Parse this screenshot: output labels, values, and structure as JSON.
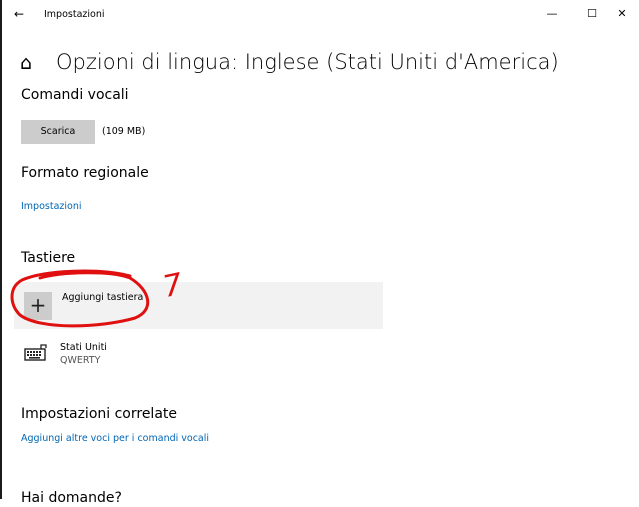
{
  "window": {
    "back_glyph": "←",
    "title": "Impostazioni",
    "minimize_glyph": "—",
    "maximize_glyph": "☐",
    "close_glyph": "✕"
  },
  "page": {
    "home_icon": "home-icon",
    "title": "Opzioni di lingua: Inglese (Stati Uniti d'America)"
  },
  "voice": {
    "header": "Comandi vocali",
    "download_label": "Scarica",
    "size": "(109 MB)"
  },
  "regional": {
    "header": "Formato regionale",
    "settings_link": "Impostazioni"
  },
  "keyboards": {
    "header": "Tastiere",
    "add_label": "Aggiungi tastiera",
    "add_icon": "plus-icon",
    "items": [
      {
        "name": "Stati Uniti",
        "layout": "QWERTY",
        "icon": "keyboard-icon"
      }
    ]
  },
  "related": {
    "header": "Impostazioni correlate",
    "link": "Aggiungi altre voci per i comandi vocali"
  },
  "questions": {
    "header": "Hai domande?"
  },
  "annotation": {
    "number": "7",
    "color": "#e01010"
  }
}
